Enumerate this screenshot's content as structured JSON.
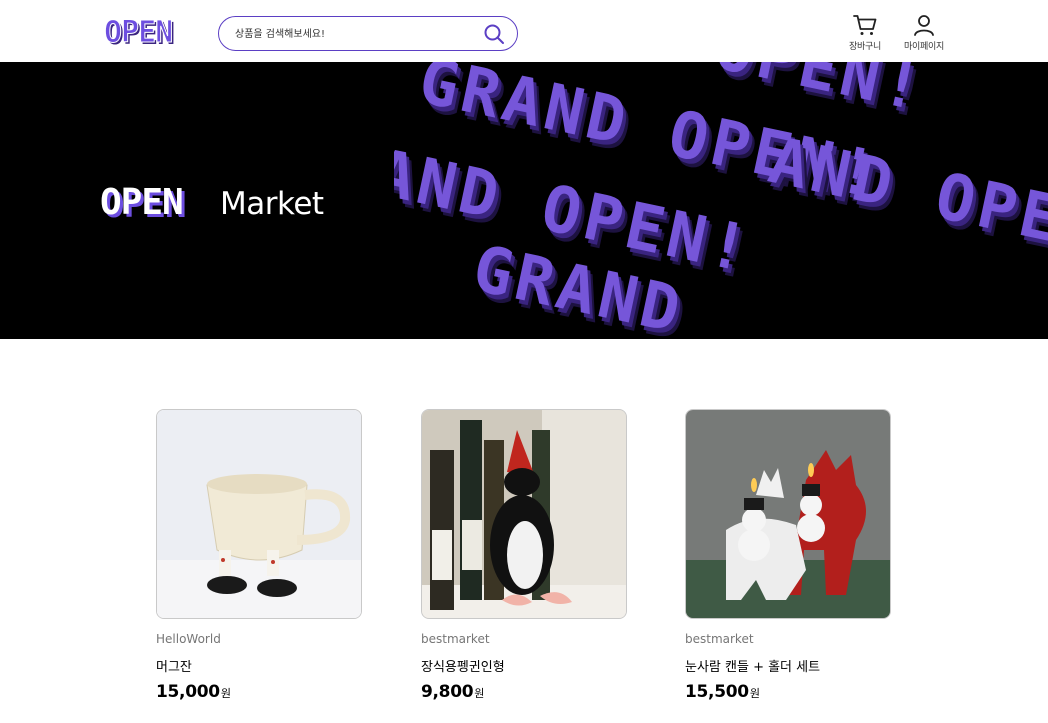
{
  "header": {
    "logo_text": "OPEN",
    "search": {
      "placeholder": "상품을 검색해보세요!"
    },
    "nav": [
      {
        "label": "장바구니",
        "icon": "cart-icon"
      },
      {
        "label": "마이페이지",
        "icon": "user-icon"
      }
    ]
  },
  "banner": {
    "logo_text": "OPEN",
    "title": "Market",
    "art_words": [
      "OPEN!",
      "GRAND OPEN!",
      "AND OPEN",
      "AND OPEN!",
      "GRAND"
    ],
    "colors": {
      "accent": "#7656d9",
      "background": "#000000"
    }
  },
  "products": [
    {
      "seller": "HelloWorld",
      "name": "머그잔",
      "price": "15,000",
      "unit": "원",
      "image": "mug-with-feet"
    },
    {
      "seller": "bestmarket",
      "name": "장식용펭귄인형",
      "price": "9,800",
      "unit": "원",
      "image": "penguin-plush"
    },
    {
      "seller": "bestmarket",
      "name": "눈사람 캔들 + 홀더 세트",
      "price": "15,500",
      "unit": "원",
      "image": "snowman-candles"
    }
  ],
  "colors": {
    "brand": "#5b3fc4",
    "text": "#000000",
    "muted": "#767676"
  }
}
